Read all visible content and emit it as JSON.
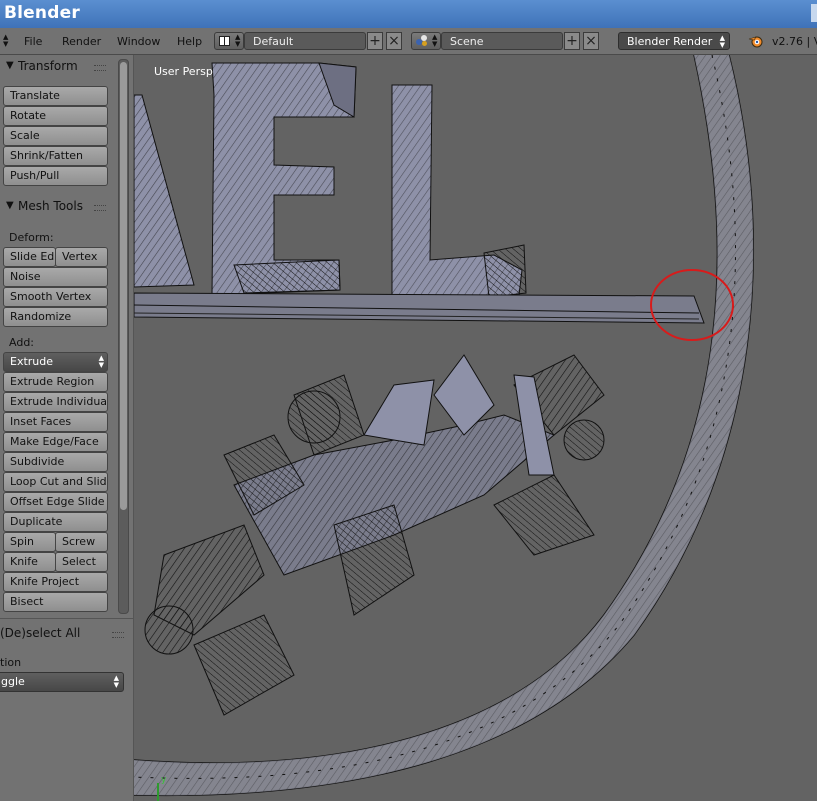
{
  "app": {
    "title": "Blender"
  },
  "menu": {
    "items": [
      "File",
      "Render",
      "Window",
      "Help"
    ],
    "layout": "Default",
    "scene": "Scene",
    "engine": "Blender Render",
    "version": "v2.76 | V"
  },
  "toolshelf": {
    "transform": {
      "title": "Transform",
      "buttons": [
        "Translate",
        "Rotate",
        "Scale",
        "Shrink/Fatten",
        "Push/Pull"
      ]
    },
    "mesh_tools": {
      "title": "Mesh Tools",
      "deform_label": "Deform:",
      "slide_edge": "Slide Ed",
      "vertex": "Vertex",
      "noise": "Noise",
      "smooth_vertex": "Smooth Vertex",
      "randomize": "Randomize",
      "add_label": "Add:",
      "extrude": "Extrude",
      "add_buttons": [
        "Extrude Region",
        "Extrude Individual",
        "Inset Faces",
        "Make Edge/Face",
        "Subdivide",
        "Loop Cut and Slide",
        "Offset Edge Slide",
        "Duplicate"
      ],
      "spin": "Spin",
      "screw": "Screw",
      "knife": "Knife",
      "select": "Select",
      "knife_project": "Knife Project",
      "bisect": "Bisect"
    },
    "operator": {
      "title": "(De)select All",
      "action_label": "tion",
      "action_value": "ggle"
    }
  },
  "viewport": {
    "label": "User Persp",
    "axis_label": "y",
    "wire_color": "#111111",
    "face_color": "#8e91a8",
    "bg_color": "#636363",
    "highlight_color": "#d81b1b"
  }
}
